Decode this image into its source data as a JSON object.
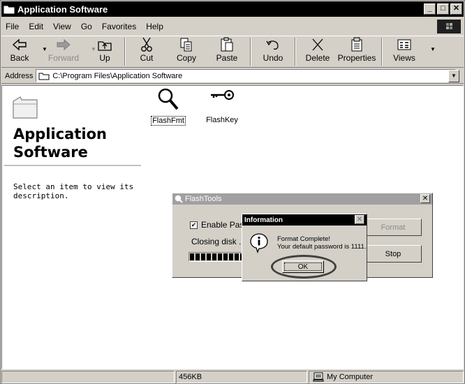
{
  "window": {
    "title": "Application Software"
  },
  "titlebar_buttons": {
    "minimize": "_",
    "maximize": "□",
    "close": "✕"
  },
  "menu": [
    "File",
    "Edit",
    "View",
    "Go",
    "Favorites",
    "Help"
  ],
  "toolbar": {
    "back": "Back",
    "forward": "Forward",
    "up": "Up",
    "cut": "Cut",
    "copy": "Copy",
    "paste": "Paste",
    "undo": "Undo",
    "delete": "Delete",
    "properties": "Properties",
    "views": "Views"
  },
  "address": {
    "label": "Address",
    "value": "C:\\Program Files\\Application Software"
  },
  "folder_pane": {
    "title_line1": "Application",
    "title_line2": "Software",
    "description": "Select an item to view its description."
  },
  "files": [
    {
      "name": "FlashFmt",
      "icon": "magnifier-icon",
      "selected": true
    },
    {
      "name": "FlashKey",
      "icon": "key-icon",
      "selected": false
    }
  ],
  "flashtools": {
    "title": "FlashTools",
    "close": "✕",
    "enable_password_label": "Enable Pass",
    "enable_password_checked": true,
    "status": "Closing disk ...",
    "format_button": "Format",
    "stop_button": "Stop"
  },
  "info_dialog": {
    "title": "Information",
    "close": "✕",
    "message_line1": "Format Complete!",
    "message_line2": "Your default password is 1111.",
    "ok_button": "OK"
  },
  "statusbar": {
    "size": "456KB",
    "zone": "My Computer"
  }
}
